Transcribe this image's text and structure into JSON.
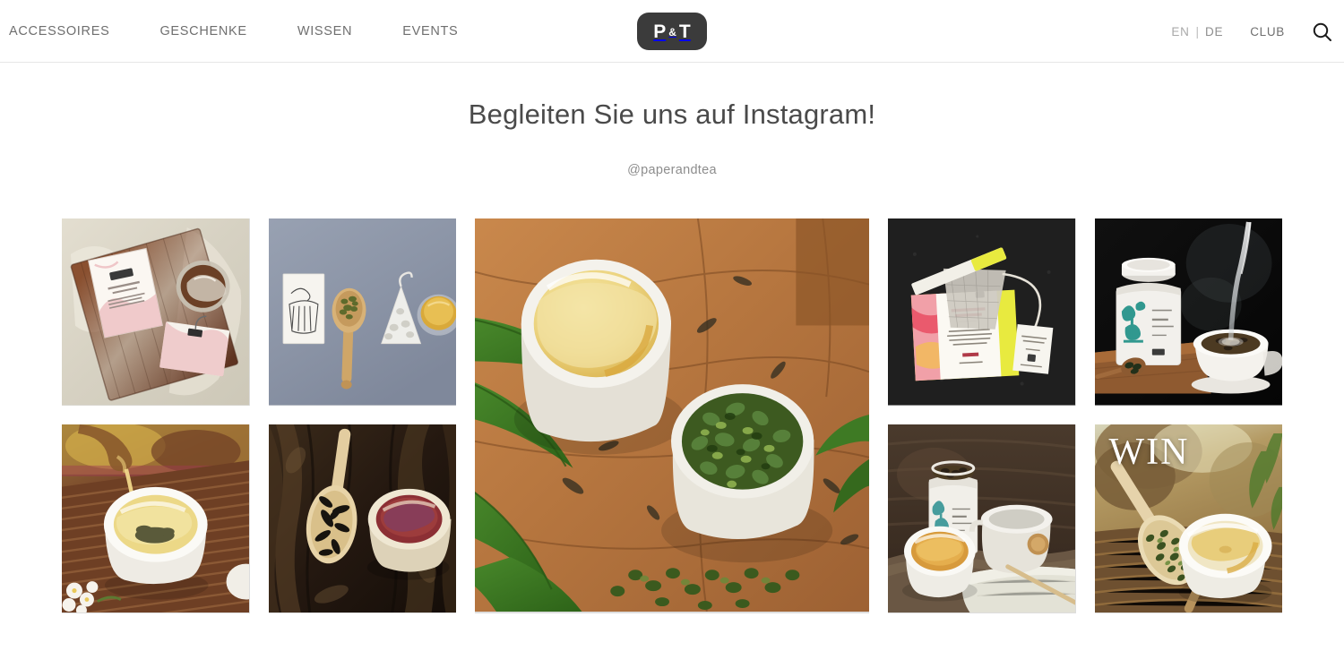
{
  "header": {
    "nav_items": [
      {
        "label": "ACCESSOIRES"
      },
      {
        "label": "GESCHENKE"
      },
      {
        "label": "WISSEN"
      },
      {
        "label": "EVENTS"
      }
    ],
    "logo": {
      "letter_p": "P",
      "amp": "&",
      "letter_t": "T",
      "name": "P&T"
    },
    "lang_en": "EN",
    "lang_sep": "|",
    "lang_de": "DE",
    "club_label": "CLUB",
    "search_icon": "search-icon"
  },
  "instagram": {
    "title": "Begleiten Sie uns auf Instagram!",
    "handle": "@paperandtea",
    "tiles": [
      {
        "id": "tile-1",
        "alt": "Tea packaging boxes and sachet on a dark wooden board over cream linen cloth",
        "overlay_text": "",
        "palette": {
          "base": "#d9d4c6",
          "accent": "#7d4a2d",
          "detail": "#e6a9ad"
        }
      },
      {
        "id": "tile-2",
        "alt": "Flat lay on blue-grey background: illustrated card, wooden scoop with tea leaves, white tea sachet and glass of golden tea",
        "overlay_text": "",
        "palette": {
          "base": "#8b95a8",
          "accent": "#f2efe9",
          "detail": "#c9a24a"
        }
      },
      {
        "id": "tile-center",
        "alt": "Overhead shot on a wooden board of a white cup filled with golden oolong infusion next to a bowl of rolled green oolong leaves, with green palm fronds",
        "overlay_text": "",
        "palette": {
          "base": "#b4763f",
          "accent": "#2f6b22",
          "detail": "#e9c96a"
        }
      },
      {
        "id": "tile-3",
        "alt": "Yellow and pink UNTER DEN LINDEN tea sachet with tag on a black background",
        "overlay_text": "",
        "palette": {
          "base": "#1b1b1b",
          "accent": "#e3e842",
          "detail": "#e8556a"
        }
      },
      {
        "id": "tile-4",
        "alt": "White tea caddy with teal illustration on a wooden tray, hot water pouring into a gaiwan, black background",
        "overlay_text": "",
        "palette": {
          "base": "#0e0e0e",
          "accent": "#f2f2f0",
          "detail": "#1d8f86"
        }
      },
      {
        "id": "tile-5",
        "alt": "Golden tea being poured into a small white cup on a bamboo mat with white blossoms",
        "overlay_text": "",
        "palette": {
          "base": "#6b3a26",
          "accent": "#e8c35e",
          "detail": "#f3efe6"
        }
      },
      {
        "id": "tile-6",
        "alt": "Wooden spoon with dark tea leaves and a cup of red-purple infusion on tree bark",
        "overlay_text": "",
        "palette": {
          "base": "#2a1d13",
          "accent": "#d8c29a",
          "detail": "#8c3a4e"
        }
      },
      {
        "id": "tile-7",
        "alt": "White tea caddy filled with leaves, teapot and cup of amber tea on rustic wood with linen cloth",
        "overlay_text": "",
        "palette": {
          "base": "#4a3a2c",
          "accent": "#eae6dc",
          "detail": "#d8a14a"
        }
      },
      {
        "id": "tile-8",
        "alt": "Wooden scoop with rolled green tea pellets beside a white cup of golden tea on a bamboo mat",
        "overlay_text": "WIN",
        "palette": {
          "base": "#8a6a3a",
          "accent": "#f1ede2",
          "detail": "#e4c469"
        }
      }
    ]
  },
  "colors": {
    "page_background": "#ffffff",
    "header_border": "#e6e6e6",
    "nav_text": "#6f6f6f",
    "title_text": "#4a4a4a",
    "handle_text": "#8d8d8d",
    "logo_background": "#3b3b3b",
    "logo_text": "#ffffff"
  }
}
